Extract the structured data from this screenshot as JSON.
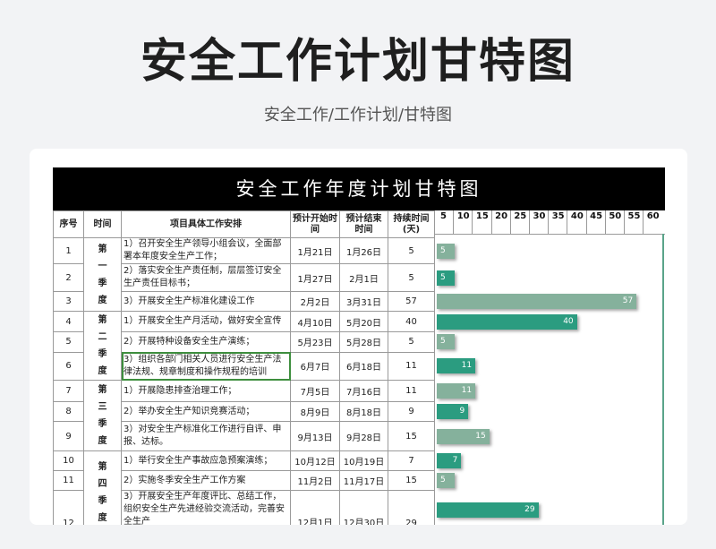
{
  "page": {
    "title": "安全工作计划甘特图",
    "subtitle": "安全工作/工作计划/甘特图"
  },
  "sheet": {
    "banner": "安全工作年度计划甘特图",
    "headers": {
      "index": "序号",
      "time": "时间",
      "task": "项目具体工作安排",
      "start": "预计开始时间",
      "end": "预计结束时间",
      "duration": "持续时间(天)"
    },
    "quarters": [
      "第一季度",
      "第二季度",
      "第三季度",
      "第四季度"
    ],
    "rows": [
      {
        "no": "1",
        "task": "1）召开安全生产领导小组会议，全面部署本年度安全生产工作；",
        "start": "1月21日",
        "end": "1月26日",
        "days": "5"
      },
      {
        "no": "2",
        "task": "2）落实安全生产责任制，层层签订安全生产责任目标书；",
        "start": "1月27日",
        "end": "2月1日",
        "days": "5"
      },
      {
        "no": "3",
        "task": "3）开展安全生产标准化建设工作",
        "start": "2月2日",
        "end": "3月31日",
        "days": "57"
      },
      {
        "no": "4",
        "task": "1）开展安全生产月活动，做好安全宣传工作；",
        "start": "4月10日",
        "end": "5月20日",
        "days": "40"
      },
      {
        "no": "5",
        "task": "2）开展特种设备安全生产演练；",
        "start": "5月23日",
        "end": "5月28日",
        "days": "5"
      },
      {
        "no": "6",
        "task": "3）组织各部门相关人员进行安全生产法律法规、规章制度和操作规程的培训",
        "start": "6月7日",
        "end": "6月18日",
        "days": "11"
      },
      {
        "no": "7",
        "task": "1）开展隐患排查治理工作；",
        "start": "7月5日",
        "end": "7月16日",
        "days": "11"
      },
      {
        "no": "8",
        "task": "2）举办安全生产知识竞赛活动；",
        "start": "8月9日",
        "end": "8月18日",
        "days": "9"
      },
      {
        "no": "9",
        "task": "3）对安全生产标准化工作进行自评、申报、达标。",
        "start": "9月13日",
        "end": "9月28日",
        "days": "15"
      },
      {
        "no": "10",
        "task": "1）举行安全生产事故应急预案演练；",
        "start": "10月12日",
        "end": "10月19日",
        "days": "7"
      },
      {
        "no": "11",
        "task": "2）实施冬季安全生产工作方案",
        "start": "11月2日",
        "end": "11月17日",
        "days": "15"
      },
      {
        "no": "12",
        "task": "3）开展安全生产年度评比、总结工作，组织安全生产先进经验交流活动，完善安全生产",
        "start": "12月1日",
        "end": "12月30日",
        "days": "29"
      }
    ]
  },
  "chart_data": {
    "type": "bar",
    "orientation": "horizontal",
    "title": "",
    "xlabel": "",
    "ylabel": "",
    "x_ticks": [
      "5",
      "10",
      "15",
      "20",
      "25",
      "30",
      "35",
      "40",
      "45",
      "50",
      "55",
      "60"
    ],
    "xlim": [
      0,
      60
    ],
    "categories": [
      "1",
      "2",
      "3",
      "4",
      "5",
      "6",
      "7",
      "8",
      "9",
      "10",
      "11",
      "12"
    ],
    "values": [
      5,
      5,
      57,
      40,
      5,
      11,
      11,
      9,
      15,
      7,
      5,
      29
    ],
    "colors": [
      "#85b19c",
      "#2b9c80",
      "#85b19c",
      "#2b9c80",
      "#85b19c",
      "#2b9c80",
      "#85b19c",
      "#2b9c80",
      "#85b19c",
      "#2b9c80",
      "#85b19c",
      "#2b9c80"
    ]
  }
}
